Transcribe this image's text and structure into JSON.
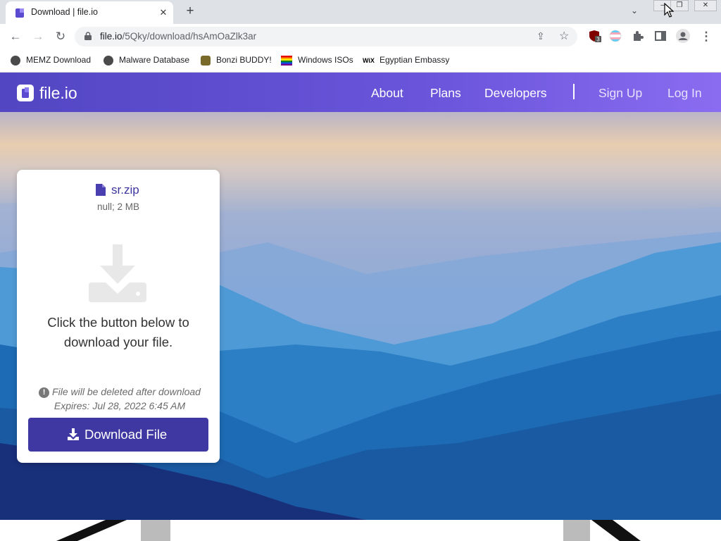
{
  "browser": {
    "tab_title": "Download | file.io",
    "tab_close": "✕",
    "new_tab": "+",
    "url_host": "file.io",
    "url_path": "/5Qky/download/hsAmOaZlk3ar",
    "extension_badge": "3",
    "bookmarks": [
      {
        "label": "MEMZ Download",
        "icon": "github-icon"
      },
      {
        "label": "Malware Database",
        "icon": "github-icon"
      },
      {
        "label": "Bonzi BUDDY!",
        "icon": "bonzi-icon"
      },
      {
        "label": "Windows ISOs",
        "icon": "rainbow-flag-icon"
      },
      {
        "label": "Egyptian Embassy",
        "icon": "wix-icon"
      }
    ],
    "wix_text": "WiX"
  },
  "site": {
    "logo": "file.io",
    "nav": [
      "About",
      "Plans",
      "Developers",
      "Sign Up",
      "Log In"
    ]
  },
  "card": {
    "file_name": "sr.zip",
    "file_meta": "null; 2 MB",
    "instruction": "Click the button below to download your file.",
    "warning_icon": "!",
    "warning": "File will be deleted after download",
    "expires": "Expires: Jul 28, 2022 6:45 AM",
    "button_label": "Download File"
  },
  "colors": {
    "brand": "#3f38a2",
    "header_start": "#5246c2",
    "header_end": "#8a6cf0"
  }
}
